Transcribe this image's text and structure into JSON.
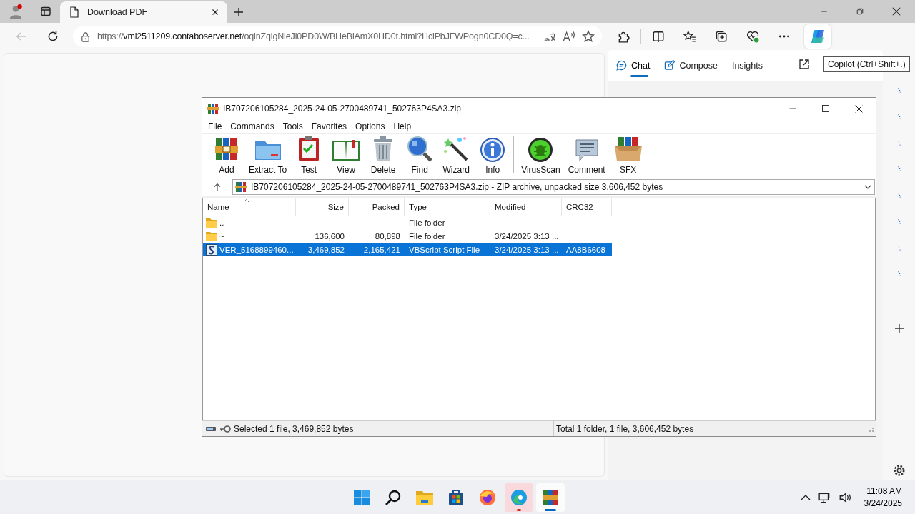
{
  "browser": {
    "tabs": [
      {
        "title": "Download PDF",
        "selected": true
      }
    ],
    "back_disabled": true,
    "url": {
      "scheme": "https://",
      "host": "vmi2511209.contaboserver.net",
      "path": "/oqinZqigNleJi0PD0W/BHeBlAmX0HD0t.html?HclPbJFWPogn0CD0Q=c..."
    }
  },
  "sidebar": {
    "tabs": [
      {
        "label": "Chat",
        "kind": "chat",
        "selected": true
      },
      {
        "label": "Compose",
        "kind": "compose",
        "selected": false
      },
      {
        "label": "Insights",
        "kind": "insights",
        "selected": false
      }
    ],
    "tooltip": "Copilot (Ctrl+Shift+.)"
  },
  "winrar": {
    "title": "IB707206105284_2025-24-05-2700489741_502763P4SA3.zip",
    "menu": [
      "File",
      "Commands",
      "Tools",
      "Favorites",
      "Options",
      "Help"
    ],
    "toolbar": [
      {
        "label": "Add",
        "kind": "add",
        "separator_before": false
      },
      {
        "label": "Extract To",
        "kind": "extract",
        "separator_before": false
      },
      {
        "label": "Test",
        "kind": "test",
        "separator_before": false
      },
      {
        "label": "View",
        "kind": "view",
        "separator_before": false
      },
      {
        "label": "Delete",
        "kind": "delete",
        "separator_before": false
      },
      {
        "label": "Find",
        "kind": "find",
        "separator_before": false
      },
      {
        "label": "Wizard",
        "kind": "wizard",
        "separator_before": false
      },
      {
        "label": "Info",
        "kind": "info",
        "separator_before": false
      },
      {
        "label": "VirusScan",
        "kind": "virusscan",
        "separator_before": true
      },
      {
        "label": "Comment",
        "kind": "comment",
        "separator_before": false
      },
      {
        "label": "SFX",
        "kind": "sfx",
        "separator_before": false
      }
    ],
    "path": "IB707206105284_2025-24-05-2700489741_502763P4SA3.zip - ZIP archive, unpacked size 3,606,452 bytes",
    "columns": [
      {
        "label": "Name",
        "kind": "text",
        "sorted": true
      },
      {
        "label": "Size",
        "kind": "number",
        "sorted": false
      },
      {
        "label": "Packed",
        "kind": "number",
        "sorted": false
      },
      {
        "label": "Type",
        "kind": "text",
        "sorted": false
      },
      {
        "label": "Modified",
        "kind": "text",
        "sorted": false
      },
      {
        "label": "CRC32",
        "kind": "text",
        "sorted": false
      }
    ],
    "rows": [
      {
        "kind": "folder",
        "cells": [
          "..",
          "",
          "",
          "File folder",
          "",
          ""
        ],
        "selected": false
      },
      {
        "kind": "folder",
        "cells": [
          "~",
          "136,600",
          "80,898",
          "File folder",
          "3/24/2025 3:13 ...",
          ""
        ],
        "selected": false
      },
      {
        "kind": "script",
        "cells": [
          "VER_5168899460...",
          "3,469,852",
          "2,165,421",
          "VBScript Script File",
          "3/24/2025 3:13 ...",
          "AA8B6608"
        ],
        "selected": true
      }
    ],
    "status_left": "Selected 1 file, 3,469,852 bytes",
    "status_right": "Total 1 folder, 1 file, 3,606,452 bytes"
  },
  "taskbar": {
    "apps": [
      {
        "kind": "start",
        "active": false,
        "attention": false
      },
      {
        "kind": "search",
        "active": false,
        "attention": false
      },
      {
        "kind": "explorer",
        "active": false,
        "attention": false
      },
      {
        "kind": "store",
        "active": false,
        "attention": false
      },
      {
        "kind": "firefox",
        "active": false,
        "attention": false
      },
      {
        "kind": "edge",
        "active": false,
        "attention": true
      },
      {
        "kind": "winrar",
        "active": true,
        "attention": false
      }
    ],
    "time": "11:08 AM",
    "date": "3/24/2025"
  }
}
